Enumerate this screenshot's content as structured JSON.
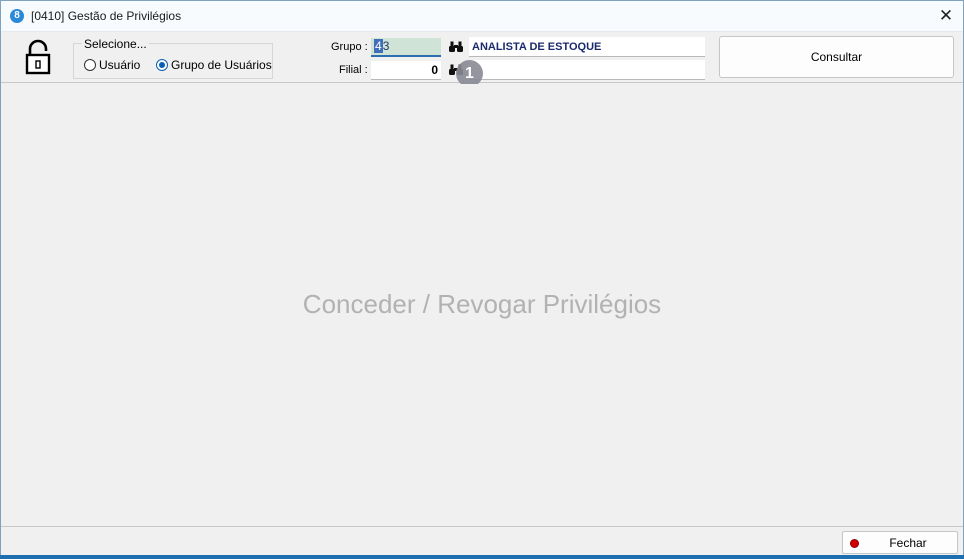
{
  "window": {
    "title": "[0410] Gestão de Privilégios",
    "app_icon_letter": "8"
  },
  "selector": {
    "legend": "Selecione...",
    "options": [
      {
        "label": "Usuário",
        "checked": false
      },
      {
        "label": "Grupo de Usuários",
        "checked": true
      }
    ]
  },
  "filters": {
    "group_label": "Grupo :",
    "group_code_selected": "4",
    "group_code_rest": "3",
    "group_description": "ANALISTA DE ESTOQUE",
    "branch_label": "Filial :",
    "branch_code": "0",
    "branch_description": ""
  },
  "badge": "1",
  "consult_label": "Consultar",
  "content": {
    "watermark": "Conceder / Revogar Privilégios"
  },
  "footer": {
    "close_label": "Fechar"
  },
  "colors": {
    "accent": "#0a5fb4",
    "selected_field_bg": "#cfe3d6",
    "description_text": "#1b2a6b",
    "close_dot": "#d40000"
  },
  "icons": [
    "lock-open-icon",
    "binoculars-icon",
    "close-icon",
    "red-dot-icon"
  ]
}
